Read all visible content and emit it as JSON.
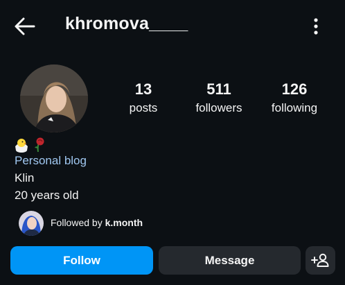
{
  "header": {
    "username": "khromova____"
  },
  "stats": [
    {
      "count": "13",
      "label": "posts"
    },
    {
      "count": "511",
      "label": "followers"
    },
    {
      "count": "126",
      "label": "following"
    }
  ],
  "bio": {
    "emojis": [
      "chick-emoji",
      "rose-emoji"
    ],
    "category": "Personal blog",
    "lines": [
      "Klin",
      "20 years old"
    ]
  },
  "followed_by": {
    "prefix": "Followed by ",
    "name": "k.month"
  },
  "actions": {
    "follow_label": "Follow",
    "message_label": "Message"
  },
  "colors": {
    "background": "#0c1014",
    "follow_button": "#0095f6",
    "secondary_button": "#25292e",
    "category_text": "#a0c7f0"
  }
}
